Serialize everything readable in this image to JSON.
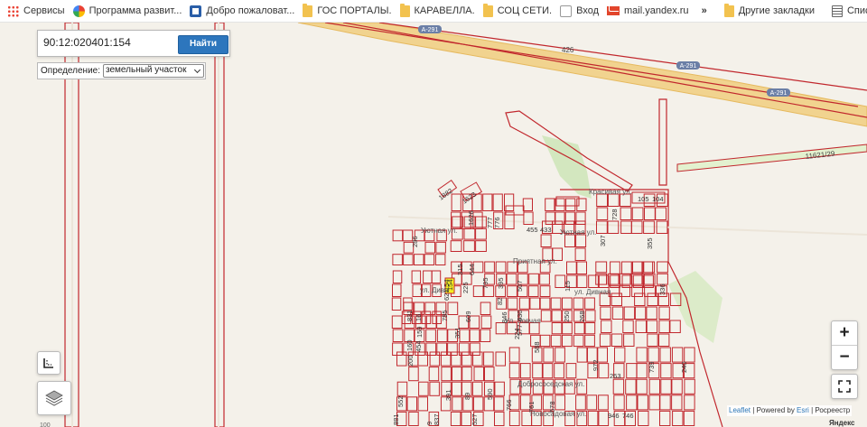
{
  "bookmarks": {
    "items": [
      {
        "label": "Сервисы",
        "icon": "apps-grid-icon"
      },
      {
        "label": "Программа развит...",
        "icon": "pinwheel-icon"
      },
      {
        "label": "Добро пожаловат...",
        "icon": "document-icon"
      },
      {
        "label": "ГОС ПОРТАЛЫ.",
        "icon": "folder-icon"
      },
      {
        "label": "КАРАВЕЛЛА.",
        "icon": "folder-icon"
      },
      {
        "label": "СОЦ СЕТИ.",
        "icon": "folder-icon"
      },
      {
        "label": "Вход",
        "icon": "gosuslugi-icon"
      },
      {
        "label": "mail.yandex.ru",
        "icon": "mail-icon"
      }
    ],
    "overflow": "»",
    "other": "Другие закладки",
    "reading_list": "Список дл"
  },
  "search": {
    "value": "90:12:020401:154",
    "button": "Найти"
  },
  "definition": {
    "label": "Определение:",
    "selected": "земельный участок"
  },
  "map": {
    "road_labels": [
      "А-291",
      "А-291",
      "А-291",
      "426",
      "11621/29"
    ],
    "street_labels": [
      "Уютная ул.",
      "Красивая ул.",
      "Уютная ул.",
      "Приятная ул.",
      "ул. Дивн",
      "ул. Дивная",
      "Ул. Зовчая",
      "Добрососедская ул.",
      "Новосадовая ул."
    ],
    "parcel_numbers": [
      "1882",
      "1623",
      "1626",
      "777",
      "776",
      "455",
      "433",
      "105",
      "104",
      "728",
      "307",
      "355",
      "286",
      "315",
      "644",
      "795",
      "395",
      "507",
      "225",
      "621",
      "154",
      "82",
      "846",
      "630",
      "115",
      "336",
      "831",
      "16",
      "785",
      "609",
      "159",
      "454",
      "351",
      "160",
      "200",
      "577",
      "224",
      "588",
      "250",
      "268",
      "972",
      "263",
      "739",
      "240",
      "552",
      "391",
      "89",
      "590",
      "766",
      "761",
      "578",
      "746",
      "881",
      "837",
      "9",
      "527",
      "946"
    ],
    "highlighted_parcel": "154",
    "corner_text": "Яндекс",
    "edge_text": "100"
  },
  "controls": {
    "zoom_in": "+",
    "zoom_out": "−"
  },
  "attribution": {
    "leaflet": "Leaflet",
    "powered": "| Powered by",
    "esri": "Esri",
    "rosreestr": "| Росреестр"
  },
  "colors": {
    "parcel_stroke": "#c1272d",
    "highway": "#f1d38f",
    "highlight": "#f5ef23",
    "green": "#cfe5b8",
    "accent": "#2d76bd"
  }
}
